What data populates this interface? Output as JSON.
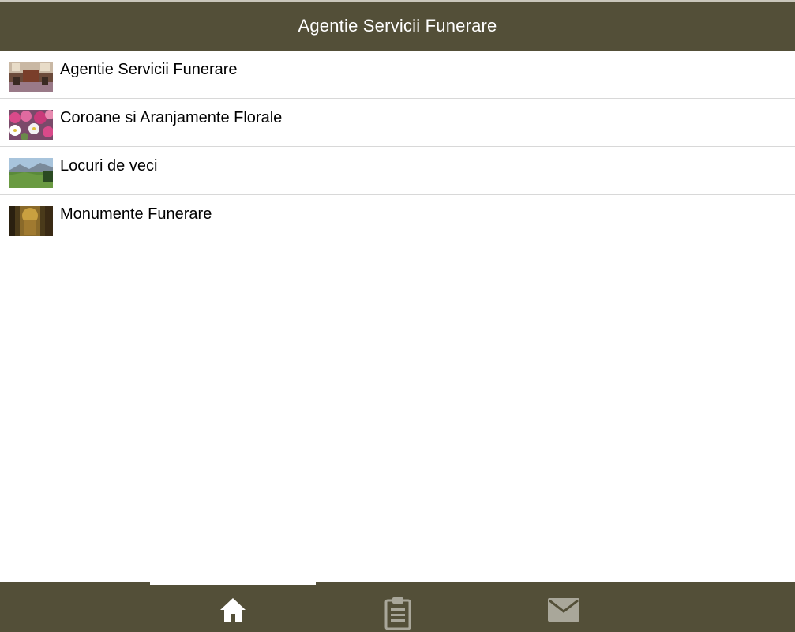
{
  "header": {
    "title": "Agentie Servicii Funerare"
  },
  "list": {
    "items": [
      {
        "label": "Agentie Servicii Funerare",
        "thumbnail": "funeral-parlor-photo"
      },
      {
        "label": "Coroane si Aranjamente Florale",
        "thumbnail": "flowers-photo"
      },
      {
        "label": "Locuri de veci",
        "thumbnail": "landscape-photo"
      },
      {
        "label": "Monumente Funerare",
        "thumbnail": "monument-photo"
      }
    ]
  },
  "tabbar": {
    "tabs": [
      {
        "icon": "home-icon",
        "active": true
      },
      {
        "icon": "clipboard-icon",
        "active": false
      },
      {
        "icon": "mail-icon",
        "active": false
      }
    ]
  },
  "colors": {
    "bar_background": "#534f38",
    "header_text": "#ffffff",
    "inactive_icon": "#a9a79a",
    "active_icon": "#ffffff",
    "divider": "#d8d8d8"
  }
}
